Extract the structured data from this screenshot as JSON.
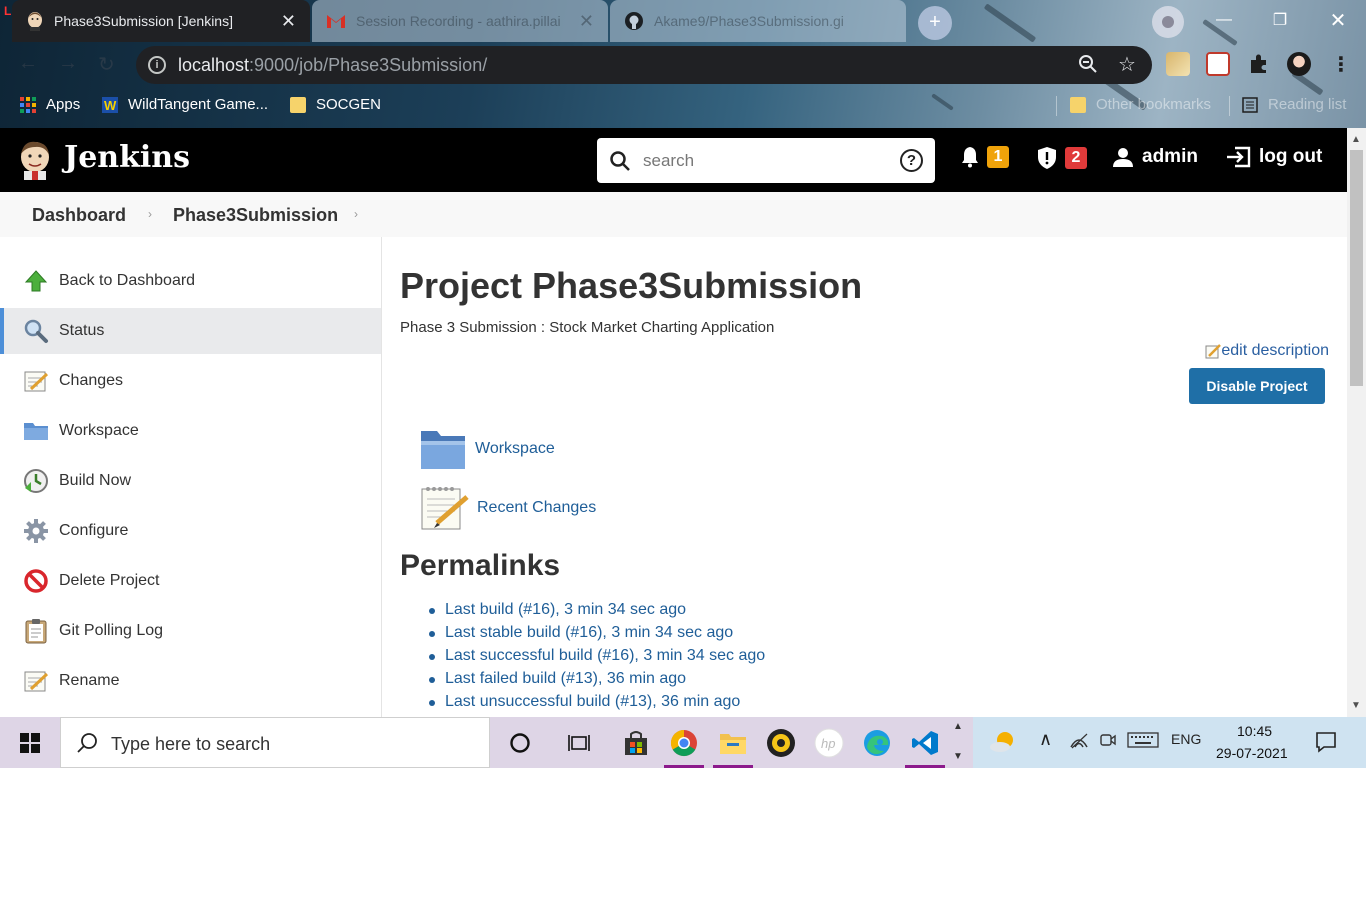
{
  "browser": {
    "tabs": [
      {
        "title": "Phase3Submission [Jenkins]",
        "active": true
      },
      {
        "title": "Session Recording - aathira.pillai",
        "active": false
      },
      {
        "title": "Akame9/Phase3Submission.gi",
        "active": false
      }
    ],
    "url_host": "localhost",
    "url_path": ":9000/job/Phase3Submission/",
    "bookmarks": [
      {
        "label": "Apps"
      },
      {
        "label": "WildTangent Game..."
      },
      {
        "label": "SOCGEN"
      }
    ],
    "bookmarks_right": [
      {
        "label": "Other bookmarks"
      },
      {
        "label": "Reading list"
      }
    ]
  },
  "jenkins": {
    "logo_text": "Jenkins",
    "search_placeholder": "search",
    "search_help": "?",
    "notifications_count": "1",
    "security_count": "2",
    "user": "admin",
    "logout": "log out",
    "colors": {
      "notification_badge": "#f0a30a",
      "security_badge": "#e03a3a",
      "primary_button": "#1f6fa7",
      "link": "#1f5e98"
    }
  },
  "breadcrumb": [
    {
      "label": "Dashboard"
    },
    {
      "label": "Phase3Submission"
    }
  ],
  "sidebar": {
    "items": [
      {
        "label": "Back to Dashboard",
        "icon": "up-arrow-icon"
      },
      {
        "label": "Status",
        "icon": "search-icon",
        "active": true
      },
      {
        "label": "Changes",
        "icon": "notepad-icon"
      },
      {
        "label": "Workspace",
        "icon": "folder-icon"
      },
      {
        "label": "Build Now",
        "icon": "clock-icon"
      },
      {
        "label": "Configure",
        "icon": "gear-icon"
      },
      {
        "label": "Delete Project",
        "icon": "no-entry-icon"
      },
      {
        "label": "Git Polling Log",
        "icon": "clipboard-icon"
      },
      {
        "label": "Rename",
        "icon": "notepad-icon"
      }
    ]
  },
  "main": {
    "title": "Project Phase3Submission",
    "description": "Phase 3 Submission : Stock Market Charting Application",
    "edit_description": "edit description",
    "disable_button": "Disable Project",
    "links": [
      {
        "label": "Workspace",
        "icon": "folder-icon"
      },
      {
        "label": "Recent Changes",
        "icon": "notepad-icon"
      }
    ],
    "permalinks_title": "Permalinks",
    "permalinks": [
      "Last build (#16), 3 min 34 sec ago",
      "Last stable build (#16), 3 min 34 sec ago",
      "Last successful build (#16), 3 min 34 sec ago",
      "Last failed build (#13), 36 min ago",
      "Last unsuccessful build (#13), 36 min ago"
    ]
  },
  "taskbar": {
    "search_placeholder": "Type here to search",
    "language": "ENG",
    "time": "10:45",
    "date": "29-07-2021"
  }
}
